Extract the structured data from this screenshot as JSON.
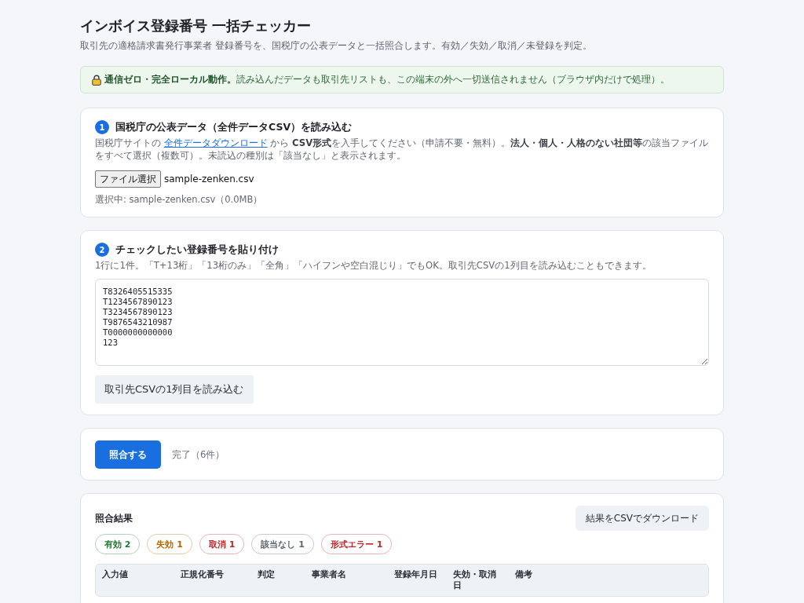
{
  "header": {
    "title": "インボイス登録番号 一括チェッカー",
    "subtitle": "取引先の適格請求書発行事業者 登録番号を、国税庁の公表データと一括照合します。有効／失効／取消／未登録を判定。"
  },
  "notice": {
    "text": "**通信ゼロ・完全ローカル動作。**読み込んだデータも取引先リストも、この端末の外へ一切送信されません（ブラウザ内だけで処理）。"
  },
  "step_load": {
    "number": "1",
    "title": "国税庁の公表データ（全件データCSV）を読み込む",
    "description": {
      "before": "国税庁サイトの ",
      "link": "全件データダウンロード",
      "after": " から **CSV形式**を入手してください（申請不要・無料）。**法人・個人・人格のない社団等**の該当ファイルをすべて選択（複数可）。未読込の種別は「該当なし」と表示されます。"
    },
    "file_button": "ファイル選択",
    "file_name": "sample-zenken.csv",
    "selection_info": "選択中: sample-zenken.csv（0.0MB）"
  },
  "step_paste": {
    "number": "2",
    "title": "チェックしたい登録番号を貼り付け",
    "description": "1行に1件。「T+13桁」「13桁のみ」「全角」「ハイフンや空白混じり」でもOK。取引先CSVの1列目を読み込むこともできます。",
    "numbers_input": {
      "value": "T8326405515335\nT1234567890123\nT3234567890123\nT9876543210987\nT0000000000000\n123"
    },
    "import_button": "取引先CSVの1列目を読み込む"
  },
  "run": {
    "button": "照合する",
    "status": "完了（6件）"
  },
  "results": {
    "title": "照合結果",
    "download_button": "結果をCSVでダウンロード",
    "summary": [
      {
        "text": "有効 2",
        "color": "#1f7a35"
      },
      {
        "text": "失効 1",
        "color": "#b26a00"
      },
      {
        "text": "取消 1",
        "color": "#c0282d"
      },
      {
        "text": "該当なし 1",
        "color": "#5f6670"
      },
      {
        "text": "形式エラー 1",
        "color": "#c0282d"
      }
    ],
    "table": {
      "columns": [
        "入力値",
        "正規化番号",
        "判定",
        "事業者名",
        "登録年月日",
        "失効・取消日",
        "備考"
      ]
    }
  }
}
